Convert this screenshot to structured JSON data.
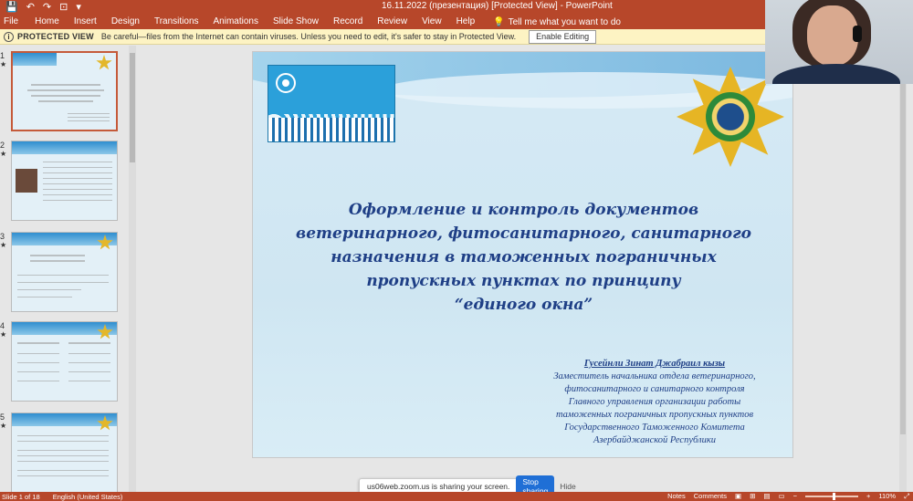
{
  "window": {
    "title": "16.11.2022 (презентация) [Protected View] - PowerPoint",
    "controls": {
      "minimize": "—",
      "maximize": "☐",
      "close": "✕"
    }
  },
  "qat": {
    "save": "💾",
    "undo": "↶",
    "redo": "↷",
    "start": "⊡",
    "customize": "▾"
  },
  "ribbon": {
    "tabs": [
      "File",
      "Home",
      "Insert",
      "Design",
      "Transitions",
      "Animations",
      "Slide Show",
      "Record",
      "Review",
      "View",
      "Help"
    ],
    "active_tab": "File",
    "tell_me": "Tell me what you want to do"
  },
  "protected_view": {
    "label": "PROTECTED VIEW",
    "message": "Be careful—files from the Internet can contain viruses. Unless you need to edit, it's safer to stay in Protected View.",
    "button": "Enable Editing"
  },
  "thumbnails": [
    {
      "number": "1",
      "star": "★",
      "selected": true
    },
    {
      "number": "2",
      "star": "★",
      "selected": false
    },
    {
      "number": "3",
      "star": "★",
      "selected": false
    },
    {
      "number": "4",
      "star": "★",
      "selected": false
    },
    {
      "number": "5",
      "star": "★",
      "selected": false
    }
  ],
  "slide": {
    "title_lines": [
      "Оформление и контроль документов",
      "ветеринарного, фитосанитарного, санитарного",
      "назначения в таможенных пограничных",
      "пропускных пунктах по принципу",
      "“единого окна”"
    ],
    "author_name": "Гусейнли Зинат Джабраил кызы",
    "author_position_lines": [
      "Заместитель начальника отдела ветеринарного,",
      "фитосанитарного и санитарного контроля",
      "Главного управления организации работы",
      "таможенных пограничных пропускных пунктов",
      "Государственного Таможенного Комитета",
      "Азербайджанской Республики"
    ]
  },
  "zoom_share": {
    "text": "us06web.zoom.us is sharing your screen.",
    "stop": "Stop sharing",
    "hide": "Hide"
  },
  "status": {
    "slide": "Slide 1 of 18",
    "language": "English (United States)",
    "notes": "Notes",
    "comments": "Comments",
    "zoom": "110%"
  },
  "colors": {
    "accent": "#b7472a",
    "title_text": "#1f3f86",
    "warning_bar": "#fdf3c3"
  }
}
